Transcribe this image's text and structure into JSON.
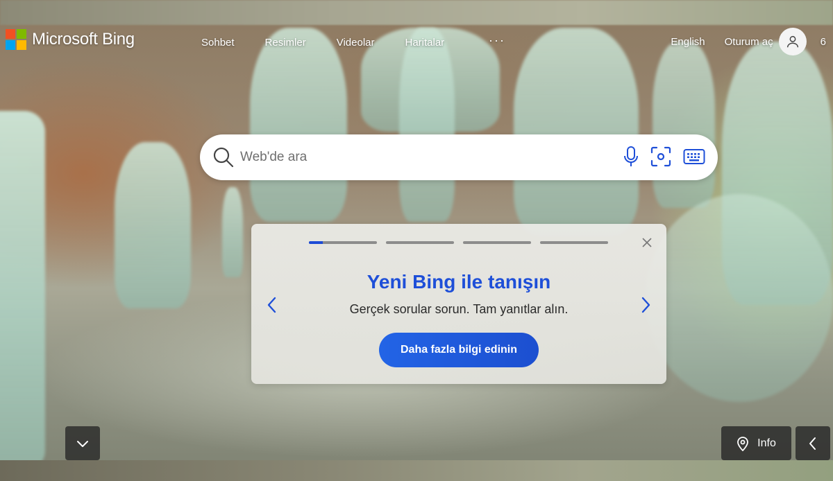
{
  "header": {
    "logo_text": "Microsoft Bing",
    "nav": [
      "Sohbet",
      "Resimler",
      "Videolar",
      "Haritalar"
    ],
    "more_label": "···",
    "language": "English",
    "signin": "Oturum aç",
    "rewards_points": "6"
  },
  "search": {
    "placeholder": "Web'de ara",
    "icons": [
      "search-icon",
      "microphone-icon",
      "visual-search-icon",
      "keyboard-icon"
    ]
  },
  "promo": {
    "title": "Yeni Bing ile tanışın",
    "subtitle": "Gerçek sorular sorun. Tam yanıtlar alın.",
    "button": "Daha fazla bilgi edinin",
    "slides_total": 4,
    "active_slide": 1,
    "active_progress": 0.2
  },
  "footer": {
    "info_label": "Info"
  },
  "colors": {
    "accent": "#1e4fd8",
    "button_gradient_start": "#2364e6",
    "button_gradient_end": "#1c4fd0"
  }
}
